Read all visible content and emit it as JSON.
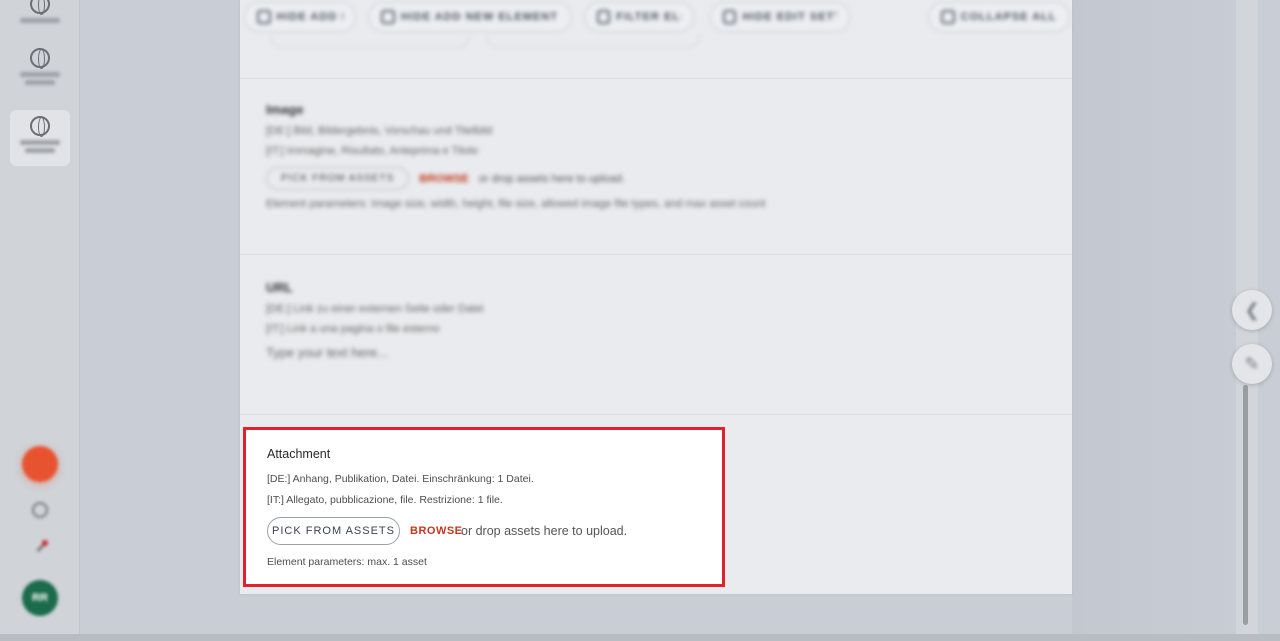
{
  "rail": {
    "items": [
      {
        "icon": "globe-icon"
      },
      {
        "icon": "globe-icon"
      },
      {
        "icon": "globe-icon",
        "active": true
      }
    ],
    "avatar_initials": "RR"
  },
  "toolbar": {
    "chips": [
      {
        "label": "HIDE ADD NEW ELEMENT",
        "icon": "grid-icon"
      },
      {
        "label": "HIDE ADD NEW ELEMENT BLOCK",
        "icon": "plus-icon"
      },
      {
        "label": "FILTER ELEMENTS",
        "icon": "filter-icon"
      },
      {
        "label": "HIDE EDIT SETTINGS",
        "icon": "calendar-icon"
      },
      {
        "label": "COLLAPSE ALL ELEMENTS",
        "icon": "collapse-icon"
      }
    ]
  },
  "sections": {
    "image": {
      "title": "Image",
      "de": "[DE:] Bild, Bildergebnis, Vorschau und Titelbild",
      "it": "[IT:] Immagine, Risultato, Anteprima e Titolo",
      "pick": "PICK FROM ASSETS",
      "browse": "BROWSE",
      "drop": "or drop assets here to upload.",
      "params": "Element parameters: Image size, width, height, file size, allowed image file types, and max asset count"
    },
    "url": {
      "title": "URL",
      "de": "[DE:] Link zu einer externen Seite oder Datei",
      "it": "[IT:] Link a una pagina o file esterno",
      "placeholder": "Type your text here..."
    }
  },
  "attachment": {
    "title": "Attachment",
    "de_line": "[DE:] Anhang, Publikation, Datei. Einschränkung: 1 Datei.",
    "it_line": "[IT:] Allegato, pubblicazione, file. Restrizione: 1 file.",
    "pick_label": "PICK FROM ASSETS",
    "browse_label": "BROWSE",
    "drop_text": "or drop assets here to upload.",
    "params": "Element parameters: max. 1 asset"
  },
  "colors": {
    "highlight": "#e0232b",
    "browse": "#c2391c",
    "accent_orange": "#e8532f",
    "avatar_green": "#1b6b4c"
  }
}
